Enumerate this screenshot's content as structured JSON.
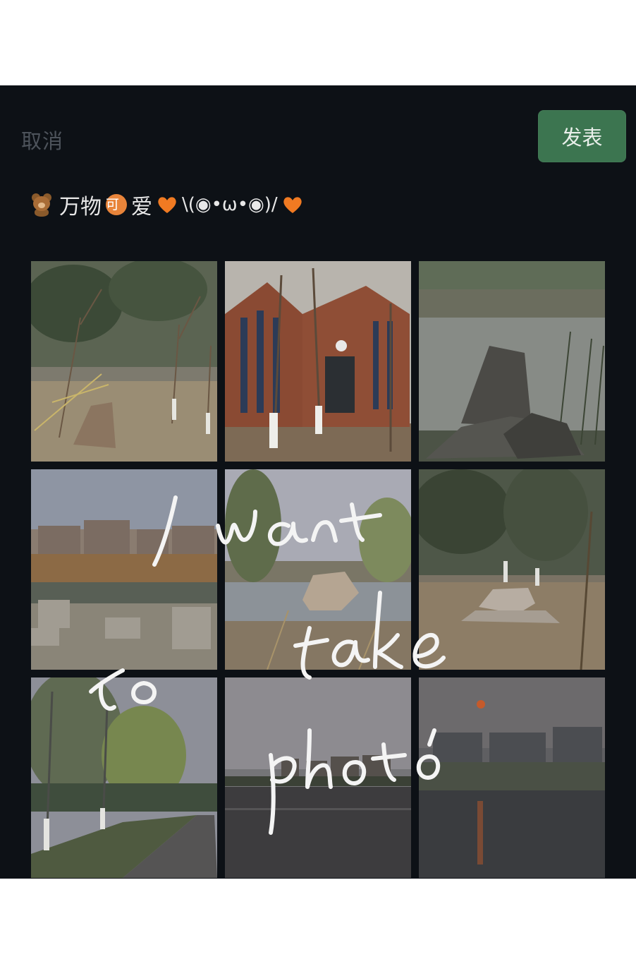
{
  "header": {
    "cancel_label": "取消",
    "post_label": "发表"
  },
  "caption": {
    "emoji_1": "teddy-bear",
    "text_1": "万物",
    "badge": "可",
    "text_2": "爱",
    "emoji_2": "orange-heart",
    "kaomoji": "\\(◉•ω•◉)/",
    "emoji_3": "orange-heart"
  },
  "photos": [
    {
      "subject": "park trees"
    },
    {
      "subject": "red brick building"
    },
    {
      "subject": "pond with rocks"
    },
    {
      "subject": "apartment buildings over pond"
    },
    {
      "subject": "lake with rock"
    },
    {
      "subject": "pine trees and rocks"
    },
    {
      "subject": "willow-lined path"
    },
    {
      "subject": "lake with buildings"
    },
    {
      "subject": "sunset over lake"
    }
  ],
  "handwriting": [
    "I want",
    "to take",
    "photo"
  ],
  "colors": {
    "post_button": "#3c7550",
    "background": "#0d1116",
    "cancel_text": "#4d535b"
  }
}
